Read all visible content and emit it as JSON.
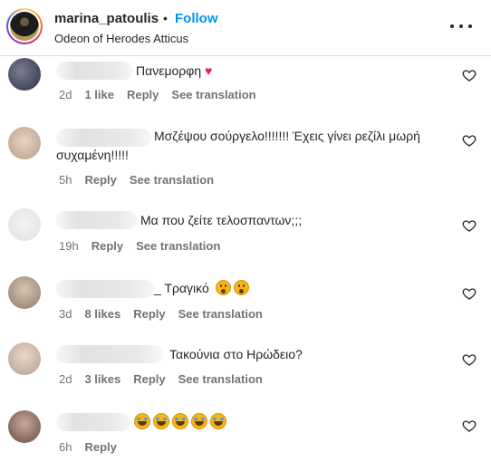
{
  "header": {
    "username": "marina_patoulis",
    "separator": "•",
    "follow_label": "Follow",
    "location": "Odeon of Herodes Atticus"
  },
  "comments": [
    {
      "text": "Πανεμορφη",
      "emoji": "red-heart",
      "time": "2d",
      "likes": "1 like",
      "reply": "Reply",
      "see_translation": "See translation"
    },
    {
      "text": "Μσζέψου σούργελο!!!!!!! Έχεις γίνει ρεζίλι μωρή συχαμένη!!!!!",
      "time": "5h",
      "reply": "Reply",
      "see_translation": "See translation"
    },
    {
      "text": "Μα που ζείτε τελοσπαντων;;;",
      "time": "19h",
      "reply": "Reply",
      "see_translation": "See translation"
    },
    {
      "text": "_ Τραγικό",
      "emoji": "astonished-face",
      "time": "3d",
      "likes": "8 likes",
      "reply": "Reply",
      "see_translation": "See translation"
    },
    {
      "text": "Τακούνια στο Ηρώδειο?",
      "time": "2d",
      "likes": "3 likes",
      "reply": "Reply",
      "see_translation": "See translation"
    },
    {
      "emoji": "face-with-tears-of-joy",
      "time": "6h",
      "reply": "Reply"
    }
  ]
}
